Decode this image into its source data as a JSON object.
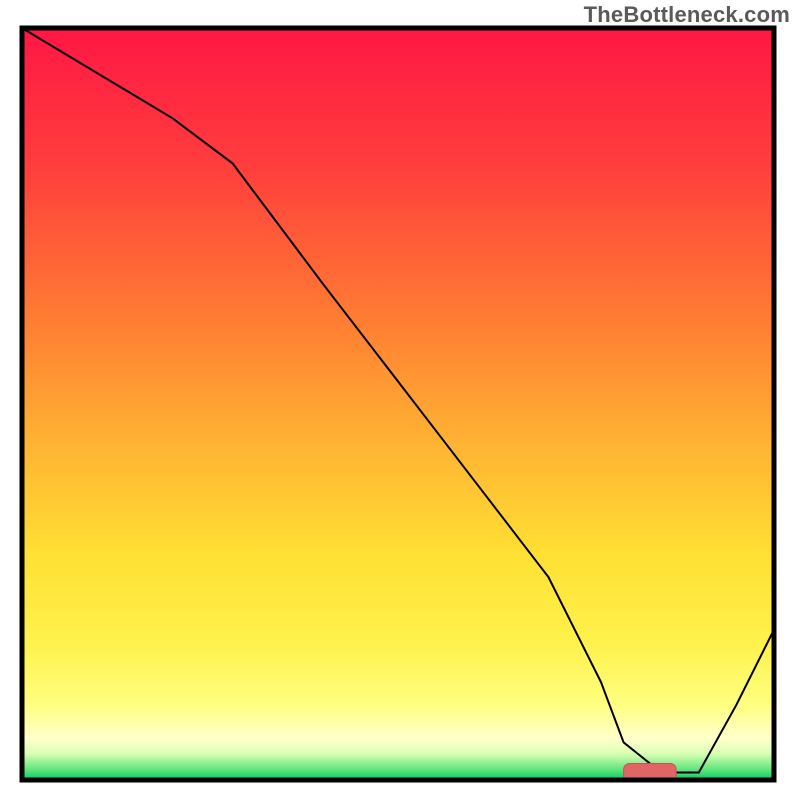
{
  "watermark_text": "TheBottleneck.com",
  "chart_data": {
    "type": "line",
    "title": "",
    "xlabel": "",
    "ylabel": "",
    "xlim": [
      0,
      100
    ],
    "ylim": [
      0,
      100
    ],
    "grid": false,
    "legend": false,
    "series": [
      {
        "name": "curve",
        "stroke": "#000000",
        "x": [
          0,
          10,
          20,
          28,
          40,
          50,
          60,
          70,
          77,
          80,
          85,
          90,
          95,
          100
        ],
        "values": [
          100,
          94,
          88,
          82,
          66,
          53,
          40,
          27,
          13,
          5,
          1,
          1,
          10,
          20
        ]
      },
      {
        "name": "marker-bar",
        "type": "bar-segment",
        "x_range": [
          80,
          87
        ],
        "y": 1,
        "color": "#e06666",
        "stroke": "#d34e4e",
        "thickness_pct": 2.4
      }
    ],
    "background_gradient": {
      "orientation": "vertical",
      "stops": [
        {
          "offset": 0.0,
          "color": "#ff1744"
        },
        {
          "offset": 0.18,
          "color": "#ff3d3d"
        },
        {
          "offset": 0.38,
          "color": "#ff7a33"
        },
        {
          "offset": 0.55,
          "color": "#ffb233"
        },
        {
          "offset": 0.7,
          "color": "#ffe033"
        },
        {
          "offset": 0.82,
          "color": "#fff24d"
        },
        {
          "offset": 0.9,
          "color": "#ffff80"
        },
        {
          "offset": 0.945,
          "color": "#ffffcc"
        },
        {
          "offset": 0.965,
          "color": "#d9ffb3"
        },
        {
          "offset": 0.985,
          "color": "#66e680"
        },
        {
          "offset": 1.0,
          "color": "#00cc66"
        }
      ]
    }
  }
}
